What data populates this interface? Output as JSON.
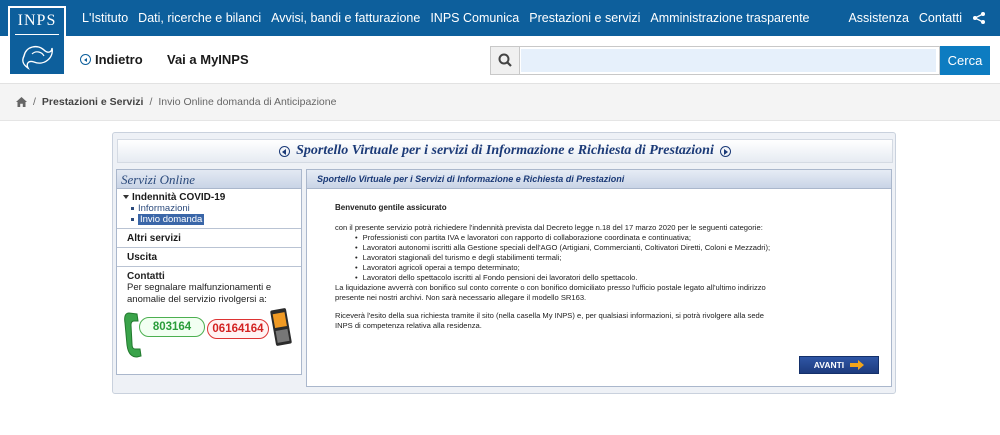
{
  "header": {
    "logo_text": "INPS",
    "nav": [
      "L'Istituto",
      "Dati, ricerche e bilanci",
      "Avvisi, bandi e fatturazione",
      "INPS Comunica",
      "Prestazioni e servizi",
      "Amministrazione trasparente"
    ],
    "right": [
      "Assistenza",
      "Contatti"
    ],
    "share_icon": "share-icon"
  },
  "subbar": {
    "back_label": "Indietro",
    "myinps_label": "Vai a MyINPS",
    "search_placeholder": "",
    "search_button": "Cerca"
  },
  "breadcrumb": {
    "home_icon": "home-icon",
    "items": [
      "Prestazioni e Servizi",
      "Invio Online domanda di Anticipazione"
    ]
  },
  "portal": {
    "title": "Sportello Virtuale per i servizi di Informazione e Richiesta di Prestazioni",
    "sidebar": {
      "heading": "Servizi Online",
      "section_title": "Indennità COVID-19",
      "sub_items": [
        "Informazioni",
        "Invio domanda"
      ],
      "other_services": "Altri servizi",
      "exit": "Uscita",
      "contacts_title": "Contatti",
      "contacts_text": "Per segnalare malfunzionamenti e anomalie del servizio rivolgersi a:",
      "phone_landline": "803164",
      "phone_mobile": "06164164"
    },
    "main": {
      "heading": "Sportello Virtuale per i Servizi di Informazione e Richiesta di Prestazioni",
      "welcome": "Benvenuto gentile assicurato",
      "intro": "con il presente servizio potrà richiedere l'indennità prevista dal Decreto legge n.18 del 17 marzo 2020 per le seguenti categorie:",
      "categories": [
        "Professionisti con partita IVA e lavoratori con rapporto di collaborazione coordinata e continuativa;",
        "Lavoratori autonomi iscritti alla Gestione speciali dell'AGO (Artigiani, Commercianti, Coltivatori Diretti, Coloni e Mezzadri);",
        "Lavoratori stagionali del turismo e degli stabilimenti termali;",
        "Lavoratori agricoli operai a tempo determinato;",
        "Lavoratori dello spettacolo iscritti al Fondo pensioni dei lavoratori dello spettacolo."
      ],
      "liquidation_1": "La liquidazione avverrà con bonifico sul conto corrente o con bonifico domiciliato presso l'ufficio postale legato all'ultimo indirizzo",
      "liquidation_2": "presente nei nostri archivi. Non sarà necessario allegare il modello SR163.",
      "outcome_1": "Riceverà l'esito della sua richiesta tramite il sito (nella casella My INPS) e, per qualsiasi informazioni, si potrà rivolgere alla sede",
      "outcome_2": "INPS di competenza relativa alla residenza.",
      "next_button": "AVANTI"
    }
  }
}
